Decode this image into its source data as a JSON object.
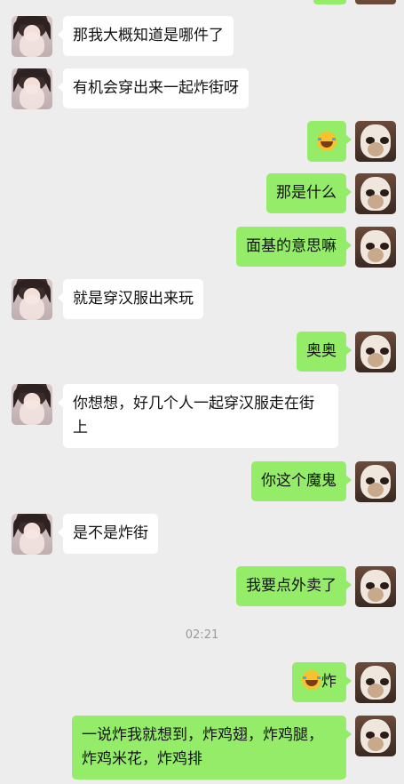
{
  "chat": {
    "messages": [
      {
        "side": "in",
        "text": "那我大概知道是哪件了"
      },
      {
        "side": "in",
        "text": "有机会穿出来一起炸街呀"
      },
      {
        "side": "out",
        "text": "",
        "emoji": "laugh-cry-emoji"
      },
      {
        "side": "out",
        "text": "那是什么"
      },
      {
        "side": "out",
        "text": "面基的意思嘛"
      },
      {
        "side": "in",
        "text": "就是穿汉服出来玩"
      },
      {
        "side": "out",
        "text": "奥奥"
      },
      {
        "side": "in",
        "text": "你想想，好几个人一起穿汉服走在街上"
      },
      {
        "side": "out",
        "text": "你这个魔鬼"
      },
      {
        "side": "in",
        "text": "是不是炸街"
      },
      {
        "side": "out",
        "text": "我要点外卖了"
      },
      {
        "side": "out",
        "text": "炸",
        "emoji": "laugh-cry-emoji"
      },
      {
        "side": "out",
        "text": "一说炸我就想到，炸鸡翅，炸鸡腿，炸鸡米花，炸鸡排"
      }
    ],
    "timestamp": "02:21"
  },
  "colors": {
    "background": "#ededed",
    "incoming_bubble": "#ffffff",
    "outgoing_bubble": "#95ec69"
  }
}
